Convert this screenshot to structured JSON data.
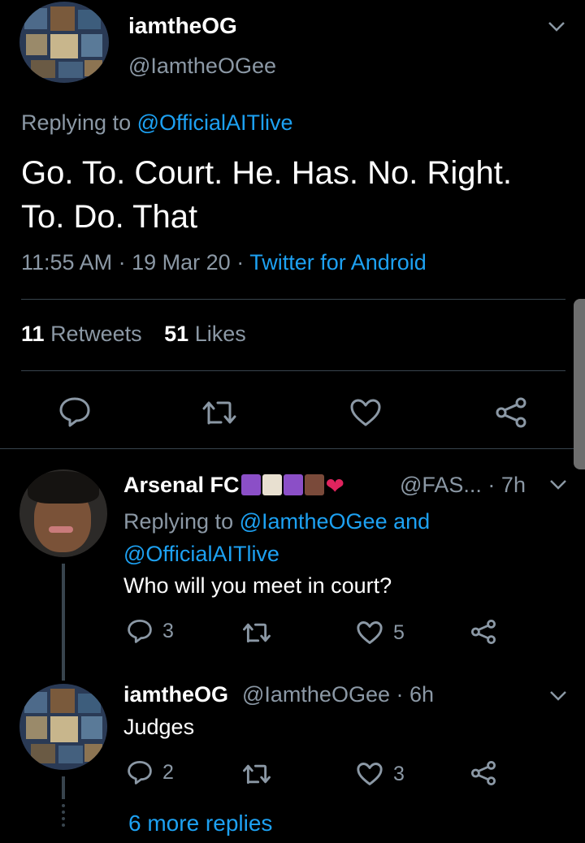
{
  "main_tweet": {
    "display_name": "iamtheOG",
    "handle": "@IamtheOGee",
    "replying_prefix": "Replying to ",
    "replying_to": "@OfficialAITlive",
    "text_line1": "Go. To. Court. He. Has. No. Right.",
    "text_line2": "To. Do. That",
    "time": "11:55 AM",
    "date": "19 Mar 20",
    "source": "Twitter for Android",
    "retweets_count": "11",
    "retweets_label": "Retweets",
    "likes_count": "51",
    "likes_label": "Likes"
  },
  "reply1": {
    "display_name": "Arsenal FC",
    "handle_time": "@FAS... · 7h",
    "replying_prefix": "Replying to ",
    "replying_to_1": "@IamtheOGee",
    "replying_and": " and",
    "replying_to_2": "@OfficialAITlive",
    "text": "Who will you meet in court?",
    "reply_count": "3",
    "like_count": "5"
  },
  "reply2": {
    "display_name": "iamtheOG",
    "handle_time": "@IamtheOGee · 6h",
    "text": "Judges",
    "reply_count": "2",
    "like_count": "3"
  },
  "more_replies": "6 more replies",
  "icons": [
    "chevron-down-icon",
    "reply-icon",
    "retweet-icon",
    "like-icon",
    "share-icon"
  ],
  "colors": {
    "background": "#000000",
    "link": "#1da1f2",
    "muted": "#8b98a5",
    "divider": "#38444d"
  }
}
